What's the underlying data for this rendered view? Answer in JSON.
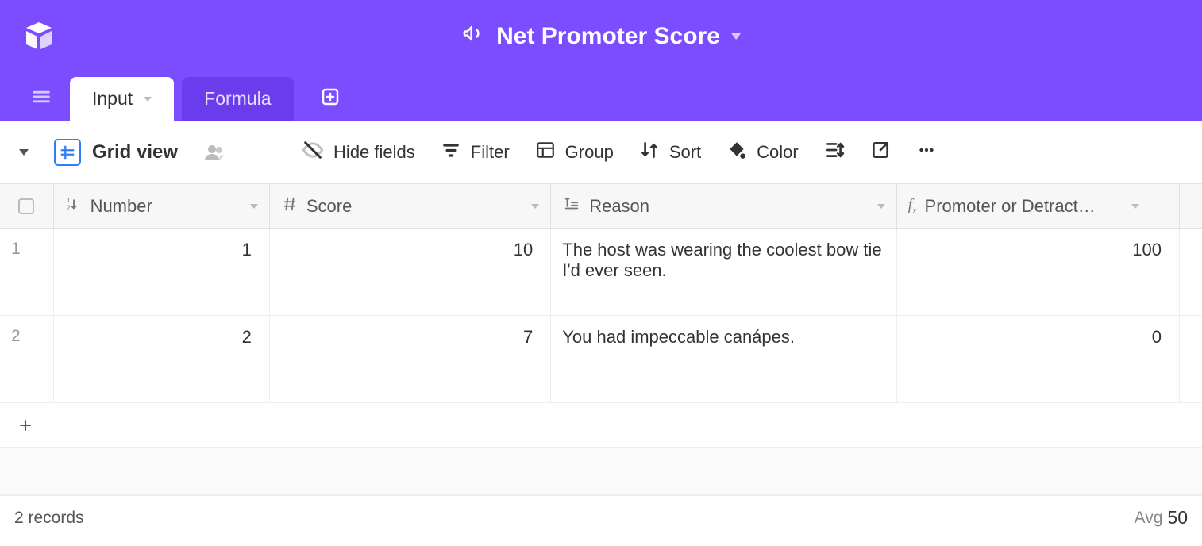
{
  "header": {
    "base_name": "Net Promoter Score",
    "tabs": [
      {
        "label": "Input",
        "active": true
      },
      {
        "label": "Formula",
        "active": false
      }
    ]
  },
  "toolbar": {
    "view_name": "Grid view",
    "hide_fields": "Hide fields",
    "filter": "Filter",
    "group": "Group",
    "sort": "Sort",
    "color": "Color"
  },
  "columns": {
    "number": "Number",
    "score": "Score",
    "reason": "Reason",
    "promoter": "Promoter or Detract…"
  },
  "rows": [
    {
      "idx": "1",
      "number": "1",
      "score": "10",
      "reason": "The host was wearing the coolest bow tie I'd ever seen.",
      "promoter": "100"
    },
    {
      "idx": "2",
      "number": "2",
      "score": "7",
      "reason": "You had impeccable canápes.",
      "promoter": "0"
    }
  ],
  "footer": {
    "record_count": "2 records",
    "avg_label": "Avg",
    "avg_value": "50"
  }
}
